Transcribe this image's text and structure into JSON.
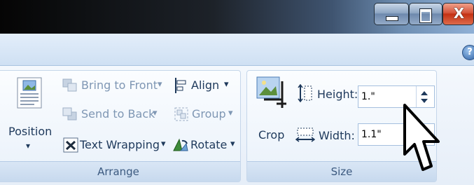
{
  "titlebar": {
    "minimize_glyph": "minimize-icon",
    "maximize_glyph": "maximize-icon",
    "close_glyph": "X"
  },
  "help": {
    "glyph": "?"
  },
  "arrange_group": {
    "label": "Arrange",
    "position_label": "Position",
    "bring_to_front": "Bring to Front",
    "send_to_back": "Send to Back",
    "text_wrapping": "Text Wrapping",
    "align": "Align",
    "group": "Group",
    "rotate": "Rotate",
    "dropdown_glyph": "▾"
  },
  "size_group": {
    "label": "Size",
    "crop_label": "Crop",
    "height_label": "Height:",
    "width_label": "Width:",
    "height_value": "1.\"",
    "width_value": "1.1\""
  },
  "colors": {
    "accent": "#1e395b",
    "disabled": "#7f97b4",
    "close_button": "#c43012"
  }
}
